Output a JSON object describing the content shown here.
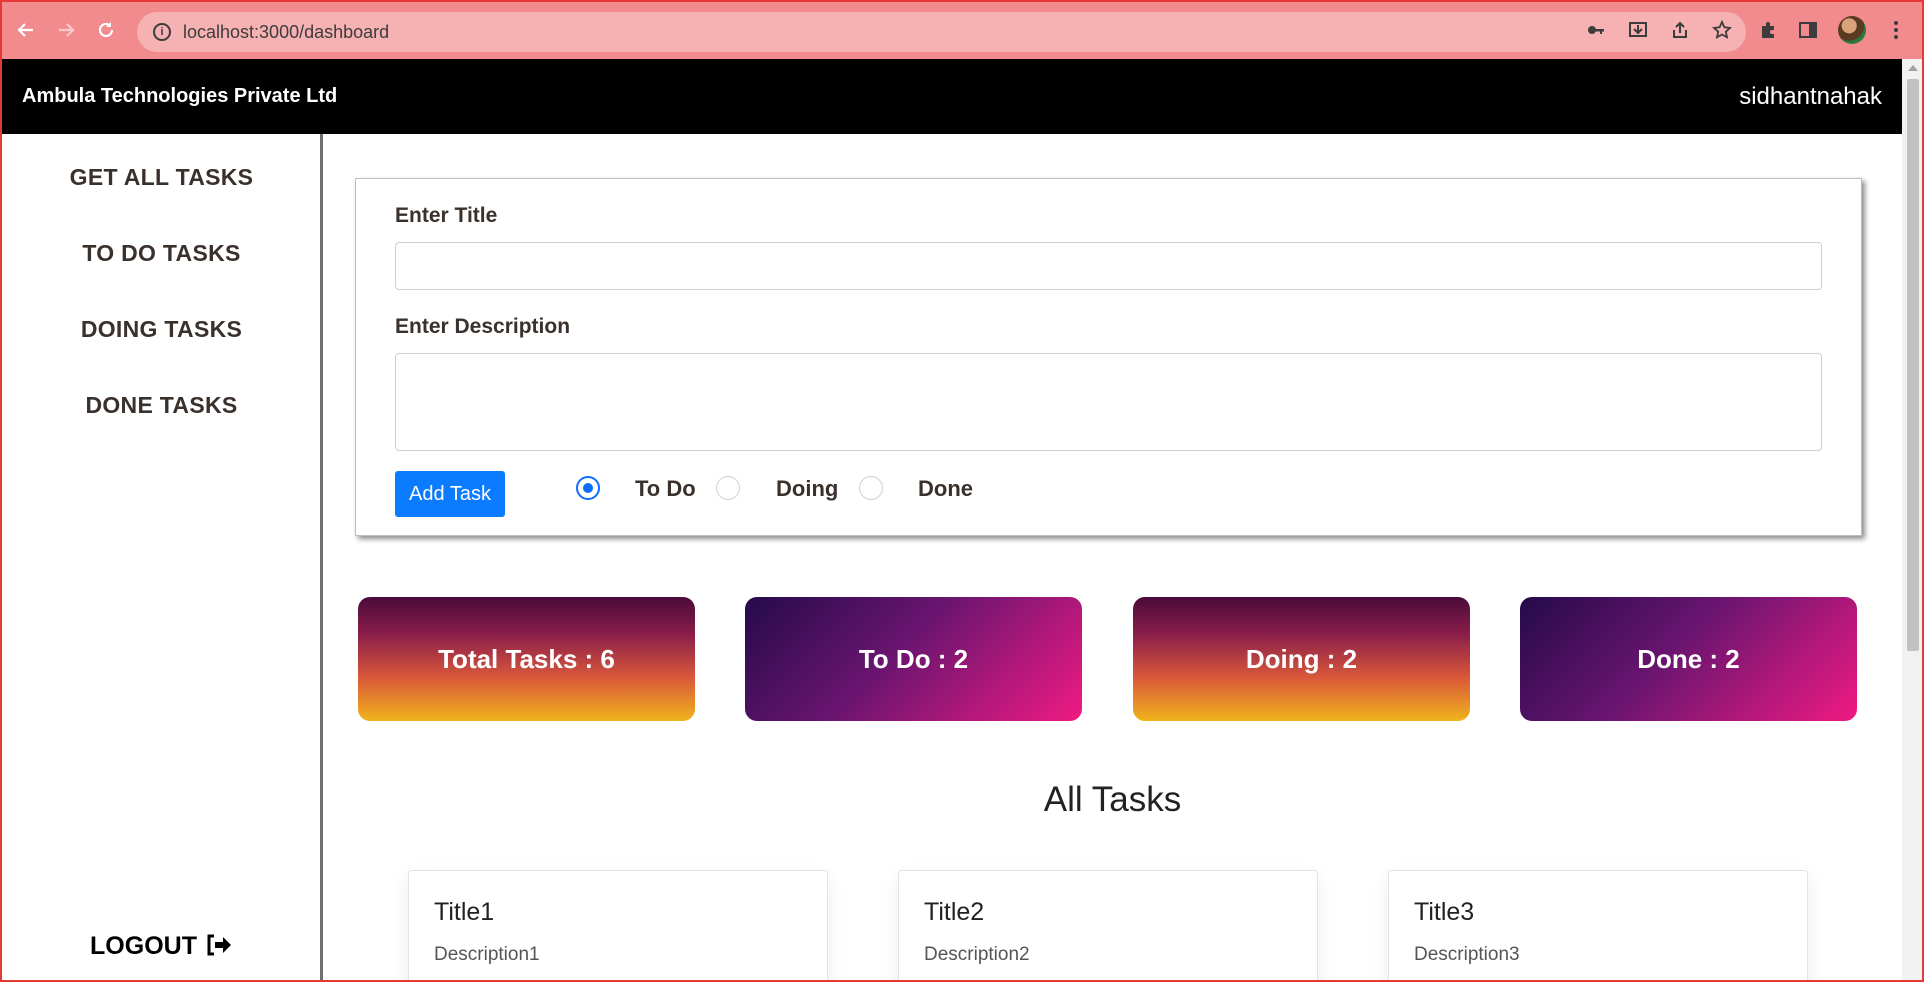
{
  "browser": {
    "url": "localhost:3000/dashboard",
    "icons": [
      "back-icon",
      "forward-icon",
      "reload-icon",
      "info-icon",
      "key-icon",
      "install-icon",
      "share-icon",
      "star-icon",
      "extensions-icon",
      "sidepanel-icon",
      "profile-avatar",
      "menu-icon"
    ]
  },
  "navbar": {
    "brand": "Ambula Technologies Private Ltd",
    "username": "sidhantnahak"
  },
  "sidebar": {
    "items": [
      {
        "label": "GET ALL TASKS"
      },
      {
        "label": "TO DO TASKS"
      },
      {
        "label": "DOING TASKS"
      },
      {
        "label": "DONE TASKS"
      }
    ],
    "logout_label": "LOGOUT"
  },
  "form": {
    "title_label": "Enter Title",
    "title_value": "",
    "description_label": "Enter Description",
    "description_value": "",
    "add_button": "Add Task",
    "status_options": [
      {
        "label": "To Do",
        "checked": true
      },
      {
        "label": "Doing",
        "checked": false
      },
      {
        "label": "Done",
        "checked": false
      }
    ]
  },
  "stats": [
    {
      "label": "Total Tasks : 6"
    },
    {
      "label": "To Do : 2"
    },
    {
      "label": "Doing : 2"
    },
    {
      "label": "Done : 2"
    }
  ],
  "colors": {
    "accent": "#0b7bff",
    "chrome": "#f28b8e",
    "navbar": "#000000"
  },
  "tasks_section": {
    "title": "All Tasks",
    "tasks": [
      {
        "title": "Title1",
        "description": "Description1"
      },
      {
        "title": "Title2",
        "description": "Description2"
      },
      {
        "title": "Title3",
        "description": "Description3"
      }
    ]
  }
}
